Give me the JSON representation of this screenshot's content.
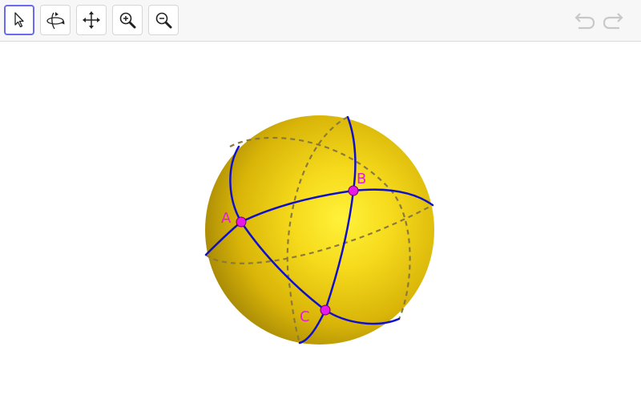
{
  "toolbar": {
    "tools": [
      {
        "name": "move-tool",
        "icon": "cursor-arrow-icon",
        "selected": true
      },
      {
        "name": "rotate-view-tool",
        "icon": "rotate-3d-icon",
        "selected": false
      },
      {
        "name": "pan-view-tool",
        "icon": "four-way-arrows-icon",
        "selected": false
      },
      {
        "name": "zoom-in-tool",
        "icon": "zoom-in-icon",
        "selected": false
      },
      {
        "name": "zoom-out-tool",
        "icon": "zoom-out-icon",
        "selected": false
      }
    ],
    "undo_icon": "undo-icon",
    "redo_icon": "redo-icon",
    "undo_enabled": false,
    "redo_enabled": false
  },
  "scene": {
    "sphere_color": "#e8c400",
    "great_circle_color": "#1010c8",
    "point_color": "#e619e6",
    "points": [
      {
        "label": "A"
      },
      {
        "label": "B"
      },
      {
        "label": "C"
      }
    ]
  }
}
